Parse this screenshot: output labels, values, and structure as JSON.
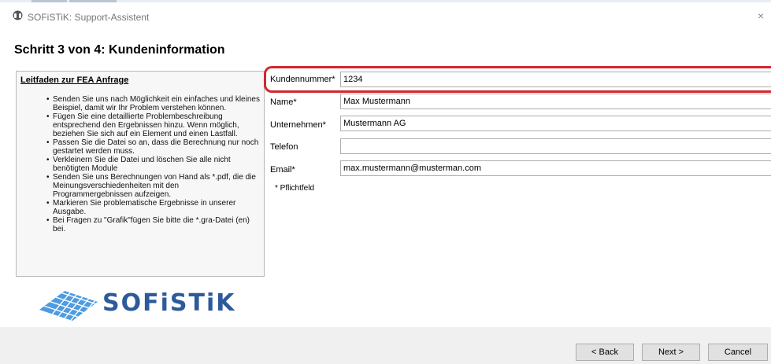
{
  "window": {
    "title": "SOFiSTiK: Support-Assistent",
    "close_glyph": "×"
  },
  "step_title": "Schritt 3 von 4: Kundeninformation",
  "guide": {
    "title": "Leitfaden zur FEA Anfrage",
    "items": [
      "Senden Sie uns nach Möglichkeit ein einfaches und kleines Beispiel, damit wir Ihr Problem verstehen können.",
      "Fügen Sie eine detaillierte Problembeschreibung entsprechend den Ergebnissen hinzu. Wenn möglich, beziehen Sie sich auf ein Element und einen Lastfall.",
      "Passen Sie die Datei so an, dass die Berechnung nur noch gestartet werden muss.",
      "Verkleinern Sie die Datei und löschen Sie alle nicht benötigten Module",
      "Senden Sie uns Berechnungen von Hand als *.pdf, die die Meinungsverschiedenheiten mit den Programmergebnissen aufzeigen.",
      "Markieren Sie problematische Ergebnisse in unserer Ausgabe.",
      "Bei Fragen zu \"Grafik\"fügen Sie bitte die *.gra-Datei (en) bei."
    ]
  },
  "logo": {
    "text": "SOFiSTiK",
    "color": "#2d5a9b"
  },
  "form": {
    "customer_number": {
      "label": "Kundennummer*",
      "value": "1234"
    },
    "name": {
      "label": "Name*",
      "value": "Max Mustermann"
    },
    "company": {
      "label": "Unternehmen*",
      "value": "Mustermann AG"
    },
    "phone": {
      "label": "Telefon",
      "value": ""
    },
    "email": {
      "label": "Email*",
      "value": "max.mustermann@musterman.com"
    },
    "required_note": "* Pflichtfeld"
  },
  "highlight_color": "#d0282e",
  "buttons": {
    "back": "< Back",
    "next": "Next >",
    "cancel": "Cancel"
  }
}
